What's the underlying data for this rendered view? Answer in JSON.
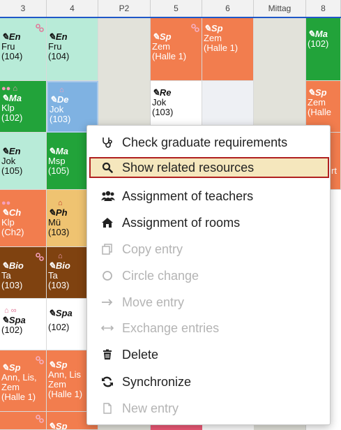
{
  "header": {
    "columns": [
      "3",
      "4",
      "P2",
      "5",
      "6",
      "Mittag",
      "8"
    ]
  },
  "cells": {
    "r1c3": {
      "subject": "En",
      "line1": "Fru",
      "line2": "(104)"
    },
    "r1c4": {
      "subject": "En",
      "line1": "Fru",
      "line2": "(104)"
    },
    "r1c5": {
      "subject": "Sp",
      "line1": "Zem",
      "line2": "(Halle 1)"
    },
    "r1c6": {
      "subject": "Sp",
      "line1": "Zem",
      "line2": "(Halle 1)"
    },
    "r1c8": {
      "subject": "Ma",
      "line1": "(102)"
    },
    "r2c3": {
      "subject": "Ma",
      "line1": "Klp",
      "line2": "(102)"
    },
    "r2c4": {
      "subject": "De",
      "line1": "Jok",
      "line2": "(103)"
    },
    "r2c5": {
      "subject": "Re",
      "line1": "Jok",
      "line2": "(103)"
    },
    "r2c8": {
      "subject": "Sp",
      "line1": "Zem",
      "line2": "(Halle"
    },
    "r3c3": {
      "subject": "En",
      "line1": "Jok",
      "line2": "(105)"
    },
    "r3c4": {
      "subject": "Ma",
      "line1": "Msp",
      "line2": "(105)"
    },
    "r3c8": {
      "line1": "rt"
    },
    "r4c3": {
      "subject": "Ch",
      "line1": "Klp",
      "line2": "(Ch2)"
    },
    "r4c4": {
      "subject": "Ph",
      "line1": "Mü",
      "line2": "(103)"
    },
    "r5c3": {
      "subject": "Bio",
      "line1": "Ta",
      "line2": "(103)"
    },
    "r5c4": {
      "subject": "Bio",
      "line1": "Ta",
      "line2": "(103)"
    },
    "r6c3": {
      "subject": "Spa",
      "line1": "(102)"
    },
    "r6c4": {
      "subject": "Spa",
      "line1": "(102)"
    },
    "r7c3": {
      "subject": "Sp",
      "line1": "Ann, Lis,",
      "line2": "Zem",
      "line3": "(Halle 1)"
    },
    "r7c4": {
      "subject": "Sp",
      "line1": "Ann, Lis",
      "line2": "Zem",
      "line3": "(Halle 1)"
    },
    "r8c4": {
      "subject": "Sp"
    }
  },
  "menu": {
    "items": [
      {
        "label": "Check graduate requirements",
        "icon": "stethoscope-icon",
        "enabled": true
      },
      {
        "label": "Show related resources",
        "icon": "search-icon",
        "enabled": true,
        "highlighted": true
      },
      {
        "label": "Assignment of teachers",
        "icon": "users-icon",
        "enabled": true
      },
      {
        "label": "Assignment of rooms",
        "icon": "home-icon",
        "enabled": true
      },
      {
        "label": "Copy entry",
        "icon": "copy-icon",
        "enabled": false
      },
      {
        "label": "Circle change",
        "icon": "circle-icon",
        "enabled": false
      },
      {
        "label": "Move entry",
        "icon": "arrow-right-icon",
        "enabled": false
      },
      {
        "label": "Exchange entries",
        "icon": "arrows-horizontal-icon",
        "enabled": false
      },
      {
        "label": "Delete",
        "icon": "trash-icon",
        "enabled": true
      },
      {
        "label": "Synchronize",
        "icon": "sync-icon",
        "enabled": true
      },
      {
        "label": "New entry",
        "icon": "file-icon",
        "enabled": false
      }
    ]
  },
  "colors": {
    "header_rule": "#1f57c8",
    "highlight_bg": "#f5e7bd",
    "highlight_border": "#b02020"
  }
}
